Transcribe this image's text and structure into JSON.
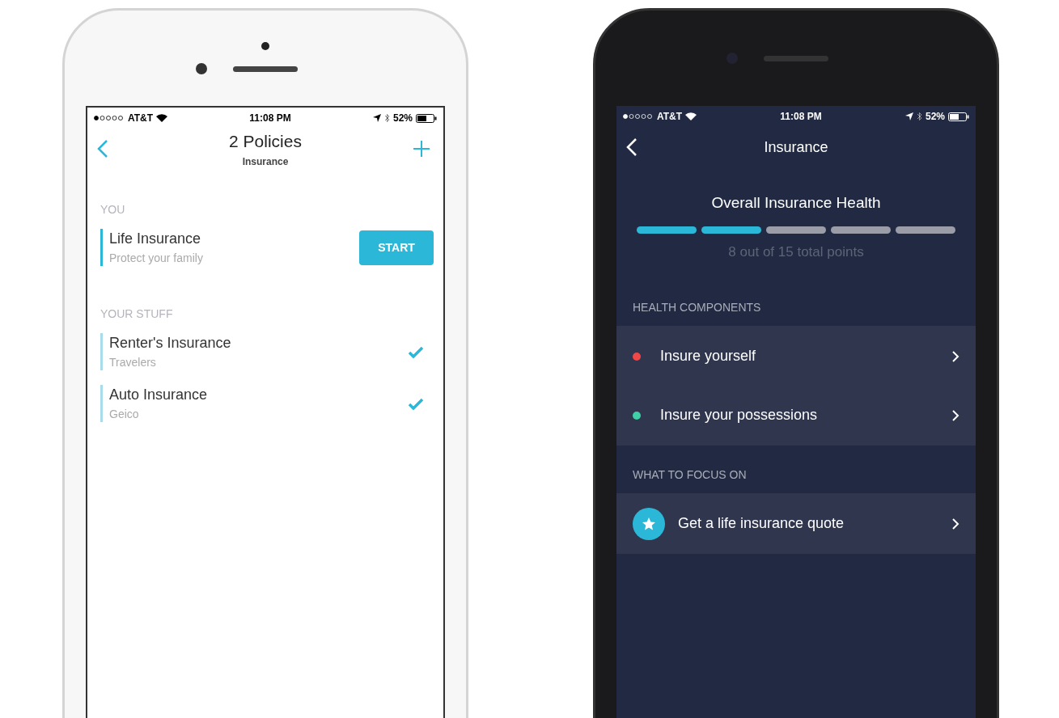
{
  "phones": [
    {
      "kind": "light",
      "status_bar": {
        "carrier": "AT&T",
        "time": "11:08 PM",
        "battery": "52%"
      },
      "nav": {
        "title": "2 Policies",
        "subtitle": "Insurance"
      },
      "sections": [
        {
          "title": "YOU",
          "items": [
            {
              "kind": "action",
              "title": "Life Insurance",
              "subtitle": "Protect your family",
              "button": "START"
            }
          ]
        },
        {
          "title": "YOUR STUFF",
          "items": [
            {
              "kind": "covered",
              "title": "Renter's Insurance",
              "subtitle": "Travelers"
            },
            {
              "kind": "covered",
              "title": "Auto Insurance",
              "subtitle": "Geico"
            }
          ]
        }
      ]
    },
    {
      "kind": "dark",
      "status_bar": {
        "carrier": "AT&T",
        "time": "11:08 PM",
        "battery": "52%"
      },
      "nav": {
        "title": "Insurance"
      },
      "health": {
        "title": "Overall Insurance Health",
        "segments": [
          {
            "filled": true
          },
          {
            "filled": true
          },
          {
            "filled": false
          },
          {
            "filled": false
          },
          {
            "filled": false
          }
        ],
        "caption": "8 out of 15 total points"
      },
      "sections": [
        {
          "title": "HEALTH COMPONENTS",
          "items": [
            {
              "kind": "component",
              "title": "Insure yourself",
              "color": "#f04848"
            },
            {
              "kind": "component",
              "title": "Insure your possessions",
              "color": "#3fd0a8"
            }
          ]
        },
        {
          "title": "WHAT TO FOCUS ON",
          "items": [
            {
              "kind": "focus",
              "title": "Get a life insurance quote"
            }
          ]
        }
      ]
    }
  ]
}
